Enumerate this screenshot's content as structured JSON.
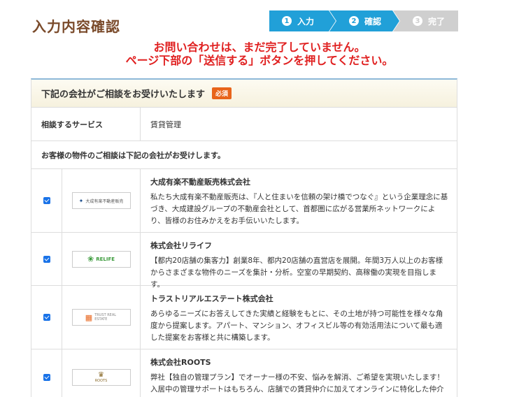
{
  "header": {
    "title": "入力内容確認"
  },
  "steps": [
    {
      "num": "1",
      "label": "入力",
      "state": "done"
    },
    {
      "num": "2",
      "label": "確認",
      "state": "current"
    },
    {
      "num": "3",
      "label": "完了",
      "state": "pending"
    }
  ],
  "warning": {
    "line1": "お問い合わせは、まだ完了していません。",
    "line2": "ページ下部の「送信する」ボタンを押してください。"
  },
  "section": {
    "title": "下記の会社がご相談をお受けいたします",
    "required_badge": "必須",
    "service_label": "相談するサービス",
    "service_value": "賃貸管理",
    "note": "お客様の物件のご相談は下記の会社がお受けします。"
  },
  "companies": [
    {
      "name": "大成有楽不動産販売株式会社",
      "logo_text": "大成有楽不動産販売",
      "checked": true,
      "desc": "私たち大成有楽不動産販売は、『人と住まいを信頼の架け橋でつなぐ』という企業理念に基づき、大成建設グループの不動産会社として、首都圏に広がる営業所ネットワークにより、皆様のお住みかえをお手伝いいたします。"
    },
    {
      "name": "株式会社リライフ",
      "logo_text": "RELIFE",
      "checked": true,
      "desc": "【都内20店舗の集客力】創業8年、都内20店舗の直営店を展開。年間3万人以上のお客様からさまざまな物件のニーズを集計・分析。空室の早期契約、高稼働の実現を目指します。"
    },
    {
      "name": "トラストリアルエステート株式会社",
      "logo_text": "TRUST REAL ESTATE",
      "checked": true,
      "desc": "あらゆるニーズにお答えしてきた実績と経験をもとに、その土地が持つ可能性を様々な角度から提案します。アパート、マンション、オフィスビル等の有効活用法について最も適した提案をお客様と共に構築します。"
    },
    {
      "name": "株式会社ROOTS",
      "logo_text": "ROOTS",
      "checked": true,
      "desc": "弊社【独自の管理プラン】でオーナー様の不安、悩みを解消、ご希望を実現いたします！入居中の管理サポートはもちろん、店舗での賃貸仲介に加えてオンラインに特化した仲介部門も設置することで抜群の集客力！"
    }
  ],
  "colors": {
    "accent": "#21a0d8",
    "warning": "#e02020",
    "title": "#7a4a2a",
    "badge": "#e8641b"
  }
}
